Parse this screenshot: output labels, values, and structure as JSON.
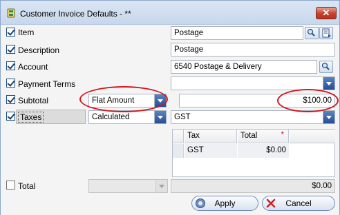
{
  "window": {
    "title": "Customer Invoice Defaults - **",
    "close_label": "✕"
  },
  "rows": {
    "item": {
      "label": "Item",
      "checked": true,
      "value": "Postage"
    },
    "description": {
      "label": "Description",
      "checked": true,
      "value": "Postage"
    },
    "account": {
      "label": "Account",
      "checked": true,
      "value": "6540  Postage & Delivery"
    },
    "payment_terms": {
      "label": "Payment Terms",
      "checked": true,
      "value": ""
    },
    "subtotal": {
      "label": "Subtotal",
      "checked": true,
      "mode": "Flat Amount",
      "amount": "$100.00"
    },
    "taxes": {
      "label": "Taxes",
      "checked": true,
      "mode": "Calculated",
      "code": "GST"
    },
    "total": {
      "label": "Total",
      "checked": false,
      "amount": "$0.00"
    }
  },
  "tax_grid": {
    "columns": [
      "Tax",
      "Total"
    ],
    "required_marker": "*",
    "rows": [
      {
        "tax": "GST",
        "total": "$0.00"
      }
    ]
  },
  "buttons": {
    "apply": "Apply",
    "cancel": "Cancel"
  },
  "colors": {
    "annotation_red": "#d8141c",
    "close_red": "#c7402a"
  }
}
